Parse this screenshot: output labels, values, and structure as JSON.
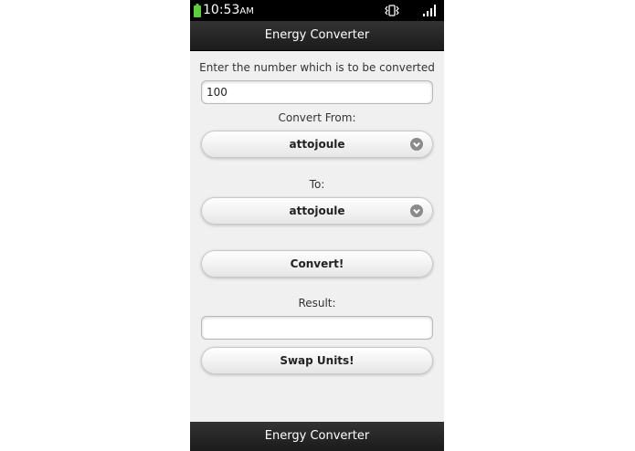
{
  "status_bar": {
    "time": "10:53",
    "ampm": "AM",
    "icons": [
      "battery-icon",
      "vibrate-icon",
      "signal-icon"
    ],
    "battery_color": "#5cd03a"
  },
  "header": {
    "title": "Energy Converter"
  },
  "form": {
    "input_label": "Enter the number which is to be converted",
    "input_value": "100",
    "from_label": "Convert From:",
    "from_selected": "attojoule",
    "to_label": "To:",
    "to_selected": "attojoule",
    "convert_button": "Convert!",
    "result_label": "Result:",
    "result_value": "",
    "swap_button": "Swap Units!"
  },
  "footer": {
    "title": "Energy Converter"
  },
  "colors": {
    "bar_background": "#1b1b1b",
    "page_background": "#f0f0f0"
  }
}
